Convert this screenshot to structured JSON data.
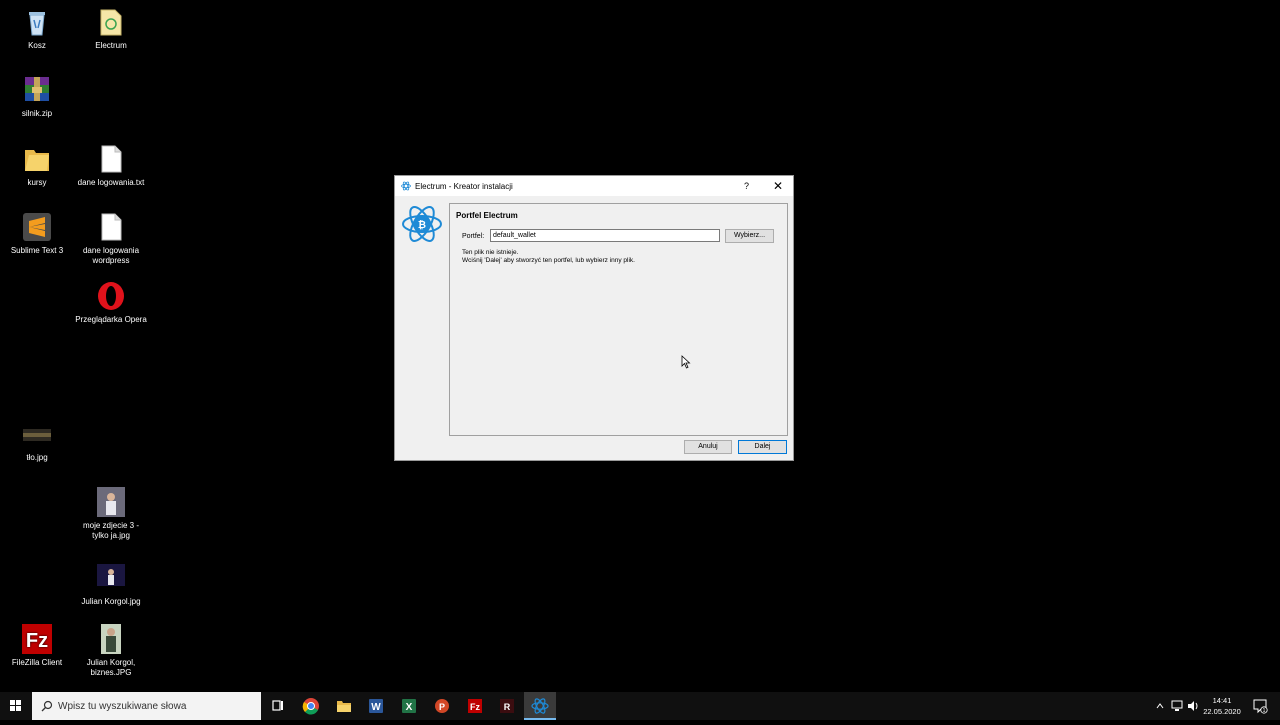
{
  "desktop": {
    "icons": [
      {
        "label": "Kosz"
      },
      {
        "label": "Electrum"
      },
      {
        "label": "silnik.zip"
      },
      {
        "label": "kursy"
      },
      {
        "label": "dane logowania.txt"
      },
      {
        "label": "Sublime Text 3"
      },
      {
        "label": "dane logowania wordpress"
      },
      {
        "label": "Przeglądarka Opera"
      },
      {
        "label": "tło.jpg"
      },
      {
        "label": "moje zdjecie 3 - tylko ja.jpg"
      },
      {
        "label": "Julian Korgol.jpg"
      },
      {
        "label": "FileZilla Client"
      },
      {
        "label": "Julian Korgol, biznes.JPG"
      }
    ]
  },
  "dialog": {
    "title": "Electrum  -  Kreator instalacji",
    "help": "?",
    "close": "✕",
    "heading": "Portfel Electrum",
    "wallet_label": "Portfel:",
    "wallet_value": "default_wallet",
    "browse_label": "Wybierz...",
    "message_line1": "Ten plik nie istnieje.",
    "message_line2": "Wciśnij 'Dalej' aby stworzyć ten portfel, lub wybierz inny plik.",
    "cancel_label": "Anuluj",
    "next_label": "Dalej"
  },
  "taskbar": {
    "search_placeholder": "Wpisz tu wyszukiwane słowa",
    "time": "14:41",
    "date": "22.05.2020",
    "notification_count": "1"
  },
  "colors": {
    "electrum_blue": "#1e8ad6",
    "accent": "#0078d7"
  }
}
